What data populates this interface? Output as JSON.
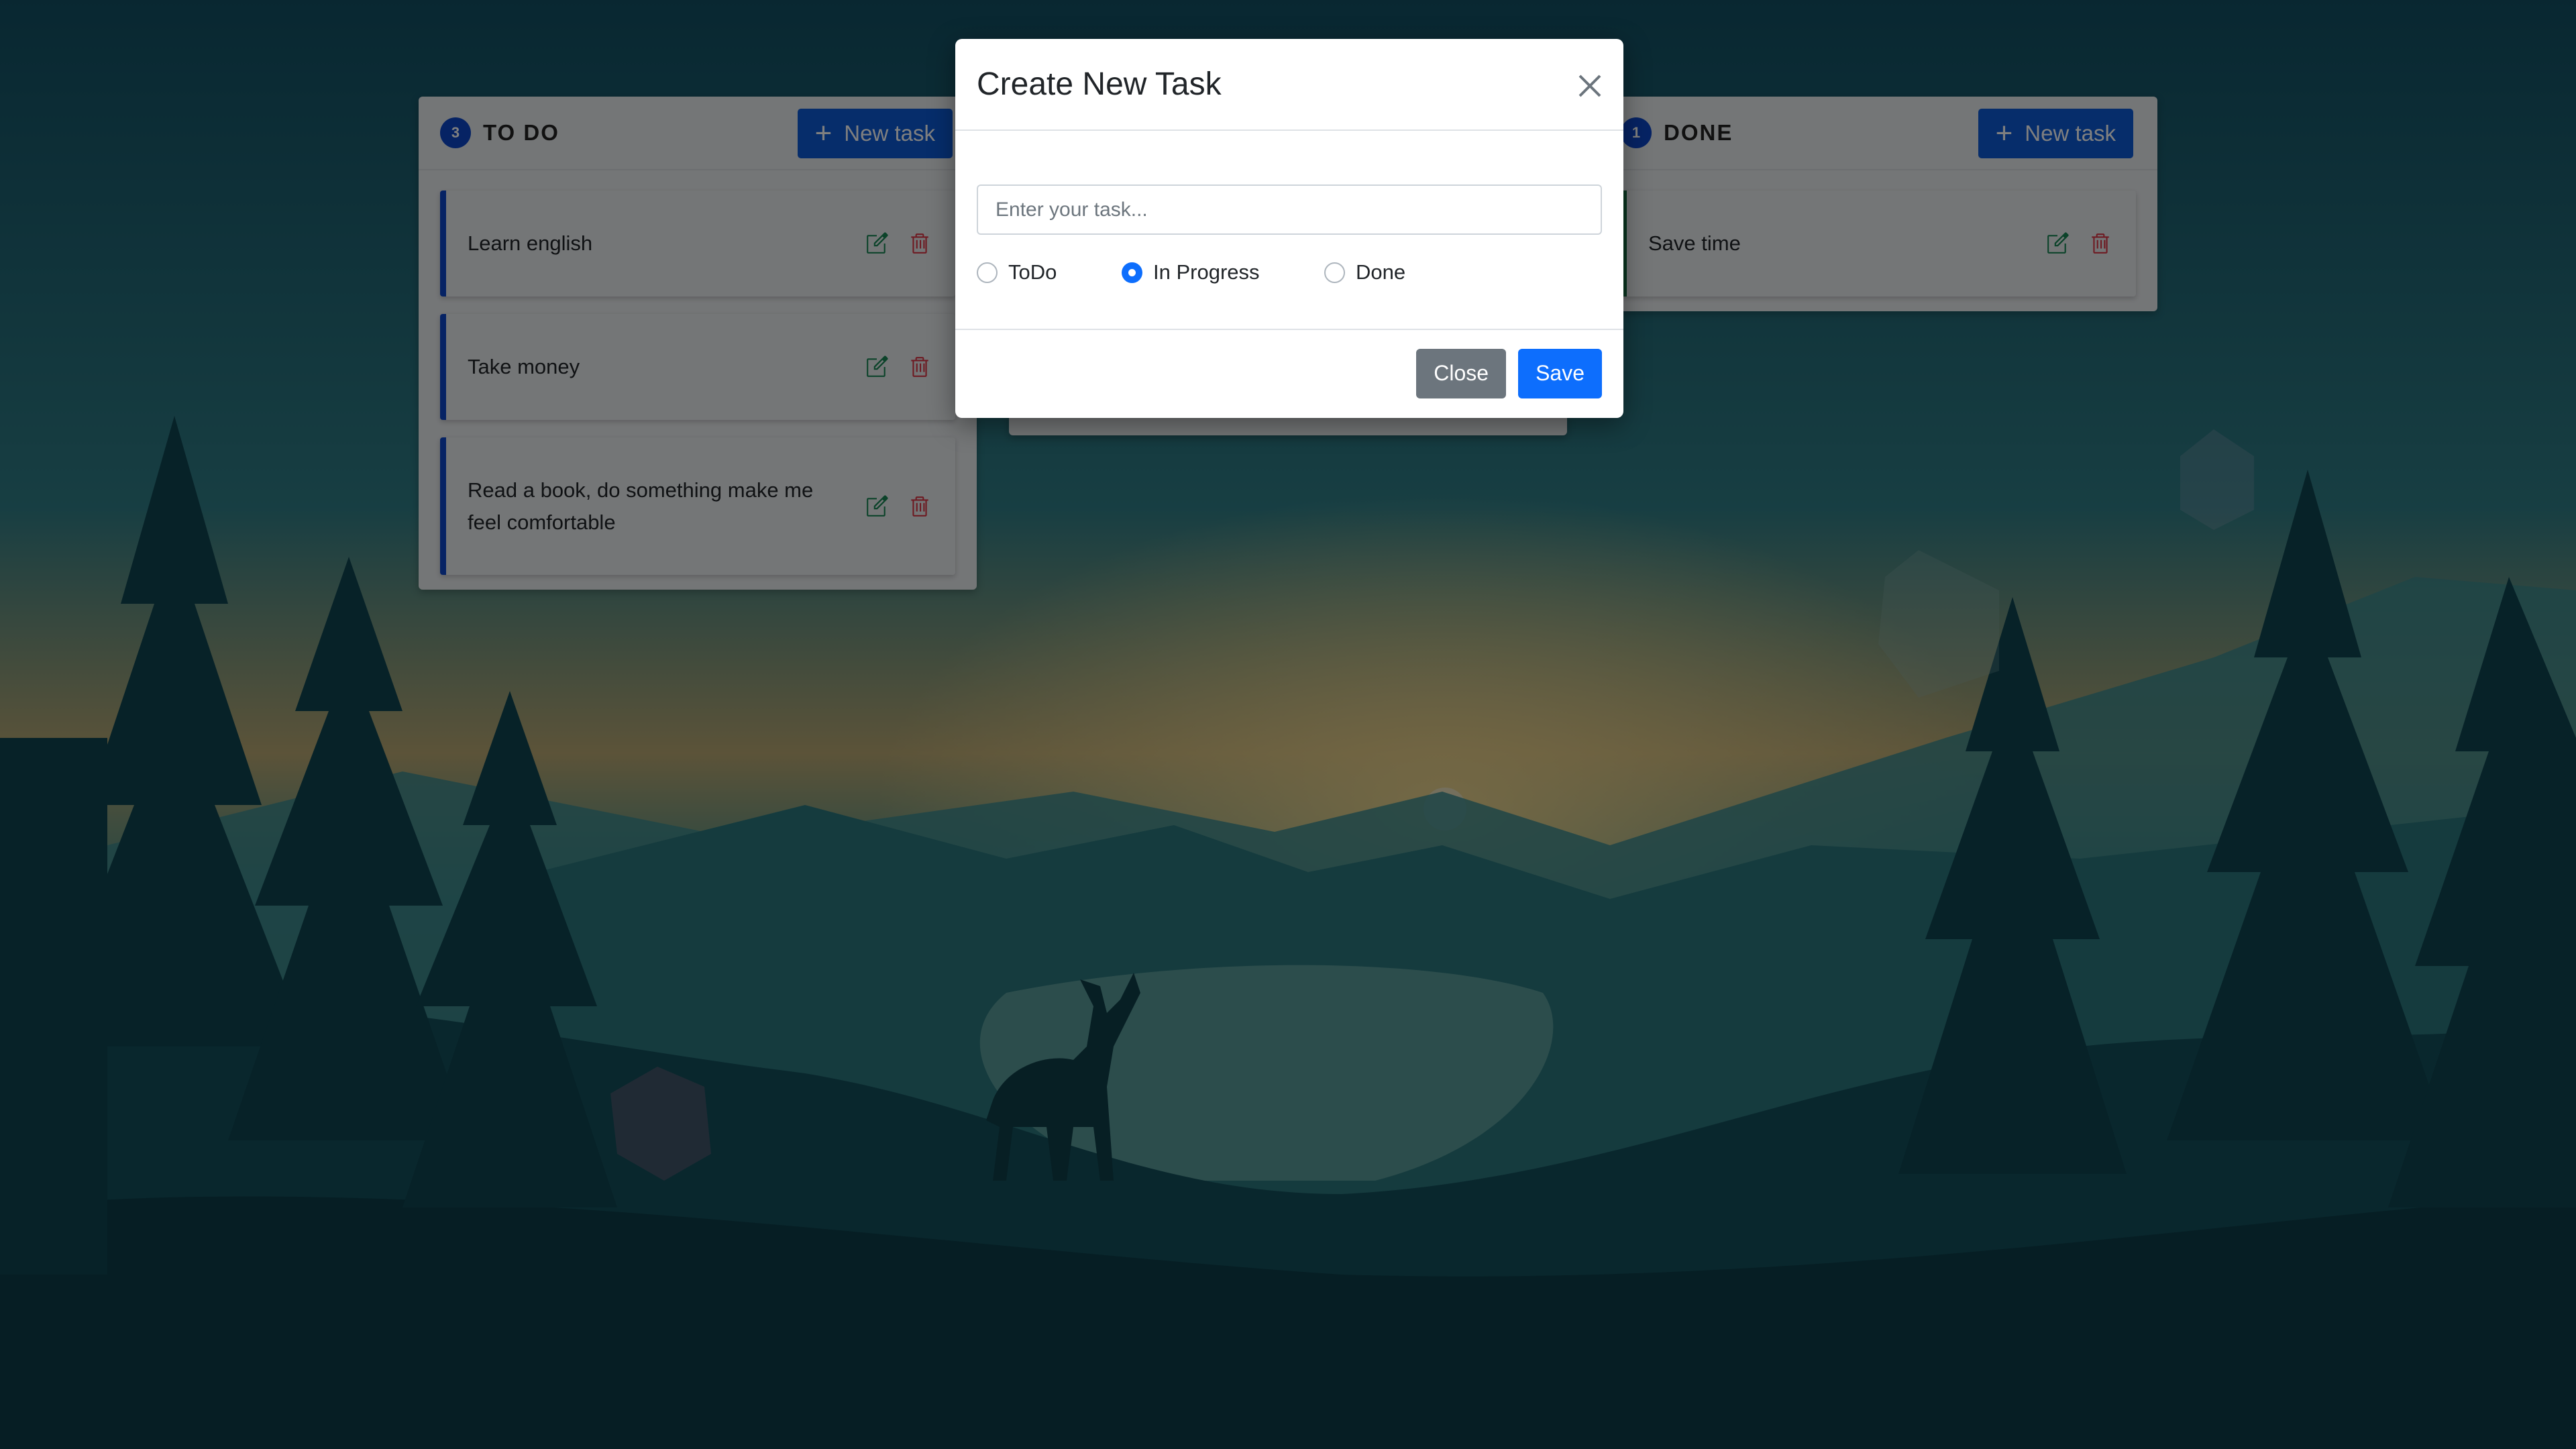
{
  "columns": {
    "todo": {
      "count": "3",
      "title": "TO DO",
      "new_task_label": "New task",
      "cards": [
        {
          "text": "Learn english"
        },
        {
          "text": "Take money"
        },
        {
          "text": "Read a book, do something make me feel comfortable"
        }
      ]
    },
    "done": {
      "count": "1",
      "title": "DONE",
      "new_task_label": "New task",
      "cards": [
        {
          "text": "Save time"
        }
      ]
    }
  },
  "modal": {
    "title": "Create New Task",
    "input_placeholder": "Enter your task...",
    "input_value": "",
    "status_options": [
      "ToDo",
      "In Progress",
      "Done"
    ],
    "selected_status": "In Progress",
    "close_label": "Close",
    "save_label": "Save"
  },
  "colors": {
    "primary": "#0d6efd",
    "todo_accent": "#0d47c9",
    "done_accent": "#146c43",
    "edit_icon": "#198754",
    "delete_icon": "#dc3545"
  },
  "icons": {
    "edit": "pencil-square-icon",
    "delete": "trash-icon",
    "close": "close-icon",
    "add": "plus-icon"
  }
}
